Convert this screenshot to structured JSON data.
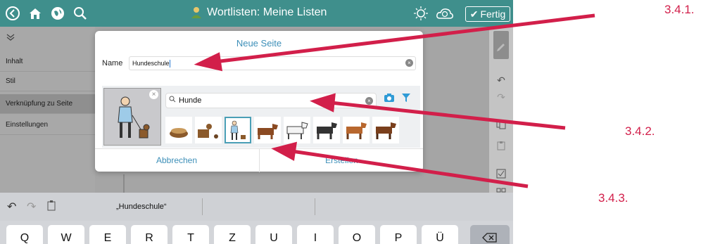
{
  "topbar": {
    "title": "Wortlisten: Meine Listen",
    "done_label": "Fertig"
  },
  "sidebar": {
    "items": [
      {
        "label": "Inhalt"
      },
      {
        "label": "Stil"
      },
      {
        "label": "Verknüpfung zu Seite"
      },
      {
        "label": "Einstellungen"
      }
    ]
  },
  "dialog": {
    "title": "Neue Seite",
    "name_label": "Name",
    "name_value": "Hundeschule",
    "search_value": "Hunde",
    "cancel_label": "Abbrechen",
    "create_label": "Erstellen"
  },
  "keyboard": {
    "suggestion": "„Hundeschule“",
    "keys": [
      "Q",
      "W",
      "E",
      "R",
      "T",
      "Z",
      "U",
      "I",
      "O",
      "P",
      "Ü"
    ]
  },
  "annotations": {
    "label_1": "3.4.1.",
    "label_2": "3.4.2.",
    "label_3": "3.4.3."
  },
  "colors": {
    "brand": "#3f8f8c",
    "accent": "#3d8fb8",
    "annotation": "#d21f4a"
  }
}
